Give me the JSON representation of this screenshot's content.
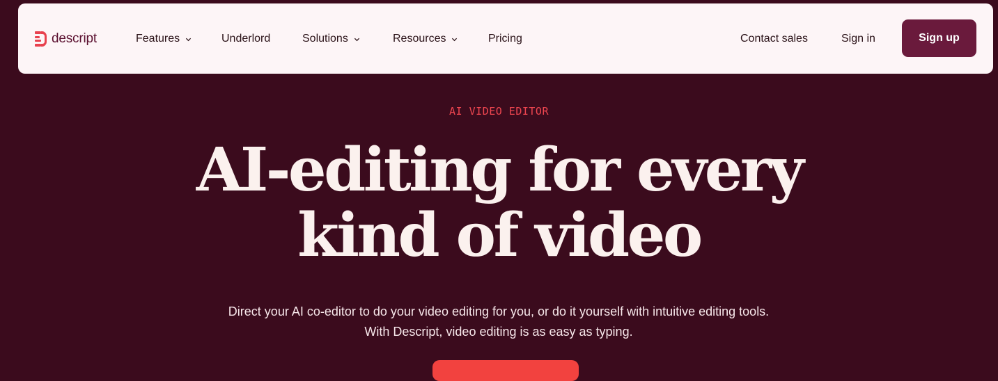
{
  "brand": {
    "name": "descript",
    "logo_icon": "descript-logo-icon"
  },
  "nav": {
    "features": "Features",
    "underlord": "Underlord",
    "solutions": "Solutions",
    "resources": "Resources",
    "pricing": "Pricing",
    "contact_sales": "Contact sales",
    "sign_in": "Sign in",
    "sign_up": "Sign up"
  },
  "hero": {
    "eyebrow": "AI VIDEO EDITOR",
    "headline": "AI-editing for every kind of video",
    "subheadline": "Direct your AI co-editor to do your video editing for you, or do it yourself with intuitive editing tools. With Descript, video editing is as easy as typing."
  },
  "colors": {
    "page_background": "#3b0b1d",
    "nav_background": "#fdf5f7",
    "accent_red": "#ef4650",
    "signup_button": "#6a1a3c",
    "headline_text": "#fbf1ee",
    "cta_button": "#f2423f"
  }
}
